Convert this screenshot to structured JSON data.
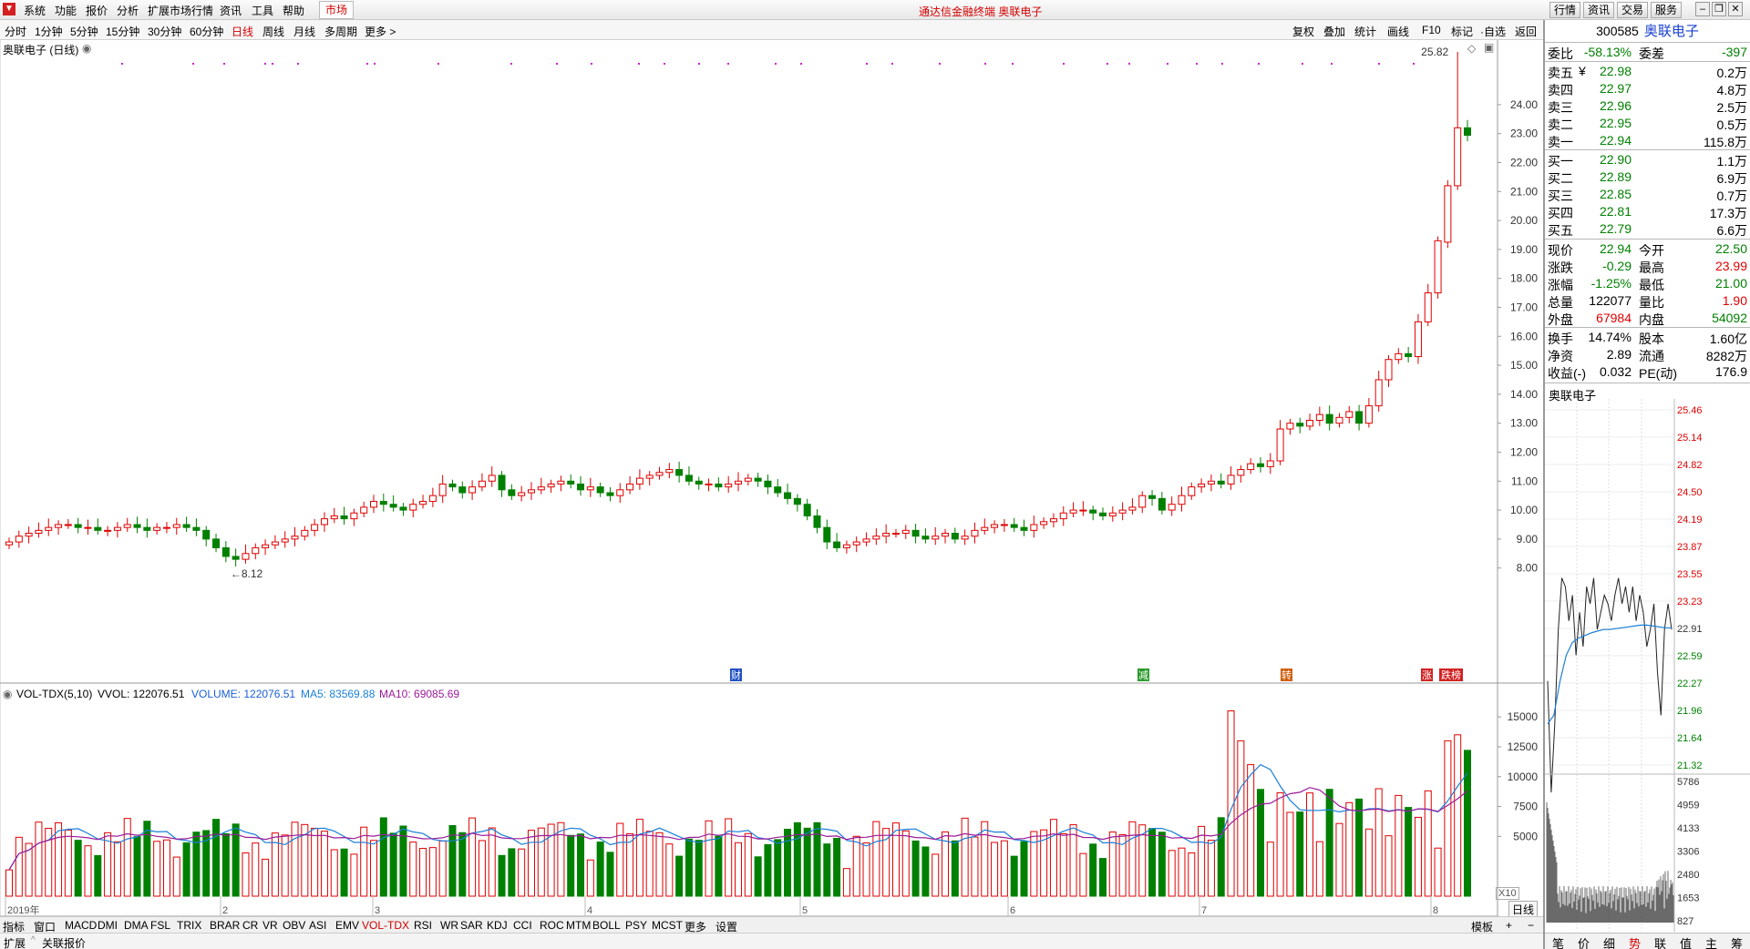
{
  "menu": {
    "items": [
      "系统",
      "功能",
      "报价",
      "分析",
      "扩展市场行情",
      "资讯",
      "工具",
      "帮助"
    ],
    "market": "市场",
    "title": "通达信金融终端  奥联电子",
    "right_buttons": [
      "行情",
      "资讯",
      "交易",
      "服务"
    ]
  },
  "periods": [
    "分时",
    "1分钟",
    "5分钟",
    "15分钟",
    "30分钟",
    "60分钟",
    "日线",
    "周线",
    "月线",
    "多周期",
    "更多 >"
  ],
  "active_period": "日线",
  "toolbar_right": [
    "复权",
    "叠加",
    "统计",
    "画线",
    "F10",
    "标记",
    "·自选",
    "返回"
  ],
  "chart": {
    "title": "奥联电子 (日线)",
    "price_ticks": [
      "8.00",
      "9.00",
      "10.00",
      "11.00",
      "12.00",
      "13.00",
      "14.00",
      "15.00",
      "16.00",
      "17.00",
      "18.00",
      "19.00",
      "20.00",
      "21.00",
      "22.00",
      "23.00",
      "24.00"
    ],
    "high_label": "25.82",
    "low_label": "8.12",
    "events": [
      "财",
      "减",
      "转",
      "涨",
      "跌榜"
    ],
    "months": [
      "2019年",
      "2",
      "3",
      "4",
      "5",
      "6",
      "7",
      "8"
    ],
    "vol_header": "VOL-TDX(5,10)",
    "vvol": "VVOL: 122076.51",
    "volume": "VOLUME: 122076.51",
    "ma5": "MA5: 83569.88",
    "ma10": "MA10: 69085.69",
    "vol_ticks": [
      "5000",
      "7500",
      "10000",
      "12500",
      "15000"
    ],
    "vol_unit": "X10",
    "period_badge": "日线"
  },
  "indicators": [
    "指标",
    "窗口",
    "MACD",
    "DMI",
    "DMA",
    "FSL",
    "TRIX",
    "BRAR",
    "CR",
    "VR",
    "OBV",
    "ASI",
    "EMV",
    "VOL-TDX",
    "RSI",
    "WR",
    "SAR",
    "KDJ",
    "CCI",
    "ROC",
    "MTM",
    "BOLL",
    "PSY",
    "MCST",
    "更多",
    "设置"
  ],
  "active_indicator": "VOL-TDX",
  "templates_label": "模板",
  "status": [
    "扩展",
    "关联报价"
  ],
  "quote": {
    "code": "300585",
    "name": "奥联电子",
    "weibi_label": "委比",
    "weibi": "-58.13%",
    "weicha_label": "委差",
    "weicha": "-397",
    "sell": [
      {
        "label": "卖五",
        "sym": "¥",
        "price": "22.98",
        "vol": "0.2万"
      },
      {
        "label": "卖四",
        "sym": "",
        "price": "22.97",
        "vol": "4.8万"
      },
      {
        "label": "卖三",
        "sym": "",
        "price": "22.96",
        "vol": "2.5万"
      },
      {
        "label": "卖二",
        "sym": "",
        "price": "22.95",
        "vol": "0.5万"
      },
      {
        "label": "卖一",
        "sym": "",
        "price": "22.94",
        "vol": "115.8万"
      }
    ],
    "buy": [
      {
        "label": "买一",
        "price": "22.90",
        "vol": "1.1万"
      },
      {
        "label": "买二",
        "price": "22.89",
        "vol": "6.9万"
      },
      {
        "label": "买三",
        "price": "22.85",
        "vol": "0.7万"
      },
      {
        "label": "买四",
        "price": "22.81",
        "vol": "17.3万"
      },
      {
        "label": "买五",
        "price": "22.79",
        "vol": "6.6万"
      }
    ],
    "stats1": [
      {
        "l1": "现价",
        "v1": "22.94",
        "c1": "green",
        "l2": "今开",
        "v2": "22.50",
        "c2": "green"
      },
      {
        "l1": "涨跌",
        "v1": "-0.29",
        "c1": "green",
        "l2": "最高",
        "v2": "23.99",
        "c2": "red"
      },
      {
        "l1": "涨幅",
        "v1": "-1.25%",
        "c1": "green",
        "l2": "最低",
        "v2": "21.00",
        "c2": "green"
      },
      {
        "l1": "总量",
        "v1": "122077",
        "c1": "black",
        "l2": "量比",
        "v2": "1.90",
        "c2": "red"
      },
      {
        "l1": "外盘",
        "v1": "67984",
        "c1": "red",
        "l2": "内盘",
        "v2": "54092",
        "c2": "green"
      }
    ],
    "stats2": [
      {
        "l1": "换手",
        "v1": "14.74%",
        "l2": "股本",
        "v2": "1.60亿"
      },
      {
        "l1": "净资",
        "v1": "2.89",
        "l2": "流通",
        "v2": "8282万"
      },
      {
        "l1": "收益(-)",
        "v1": "0.032",
        "l2": "PE(动)",
        "v2": "176.9"
      }
    ]
  },
  "mini": {
    "title": "奥联电子",
    "price_ticks": [
      "25.46",
      "25.14",
      "24.82",
      "24.50",
      "24.19",
      "23.87",
      "23.55",
      "23.23",
      "22.91",
      "22.59",
      "22.27",
      "21.96",
      "21.64",
      "21.32"
    ],
    "vol_ticks": [
      "5786",
      "4959",
      "4133",
      "3306",
      "2480",
      "1653",
      "827"
    ]
  },
  "right_tabs": [
    "笔",
    "价",
    "细",
    "势",
    "联",
    "值",
    "主",
    "筹"
  ],
  "active_right_tab": "势",
  "colors": {
    "up": "#e00000",
    "down": "#008000",
    "ma_blue": "#1a7fd8",
    "ma_purple": "#9a1a9a"
  }
}
